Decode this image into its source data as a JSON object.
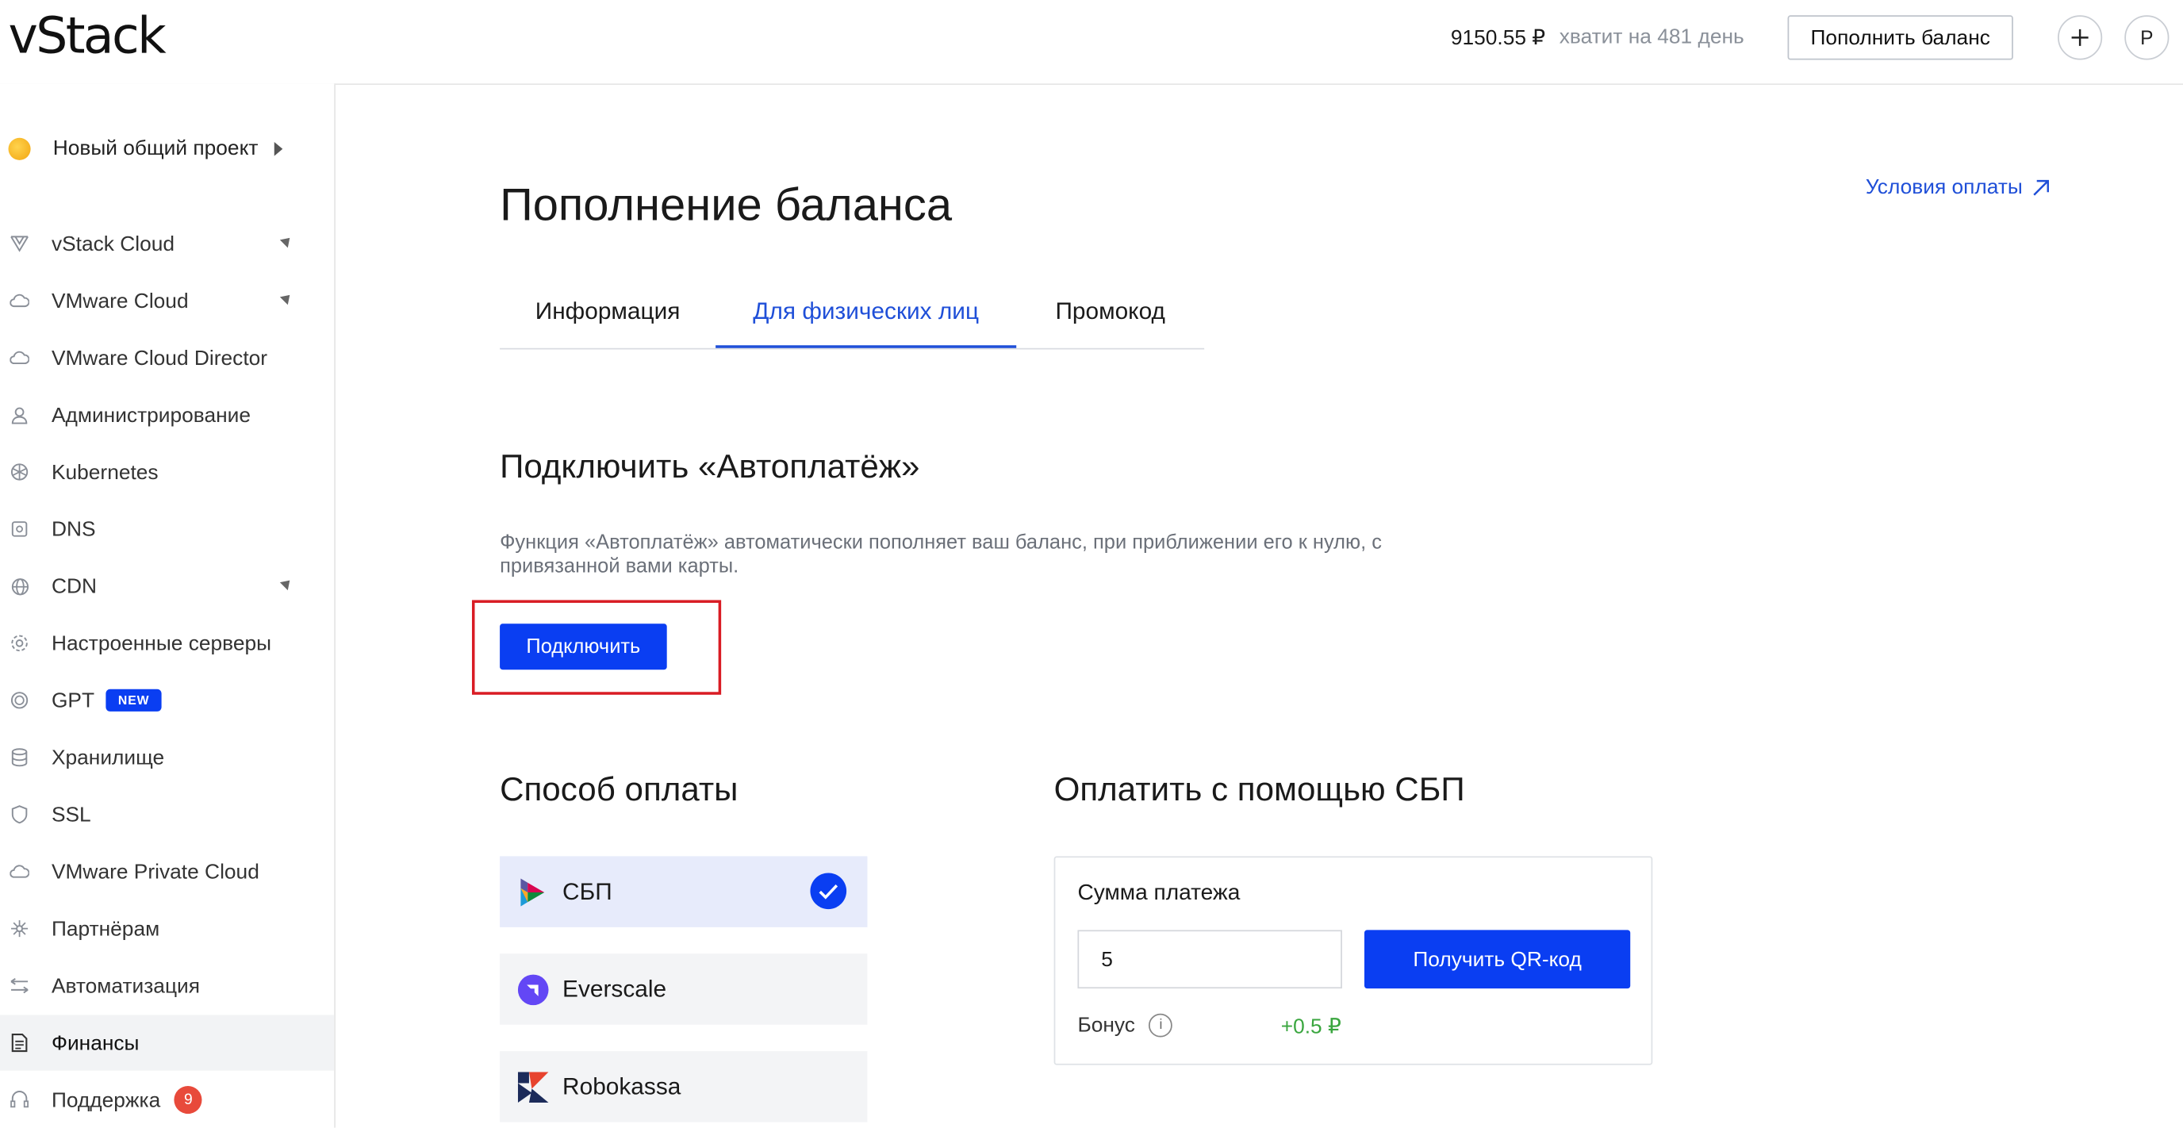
{
  "header": {
    "logo": "vStack",
    "balance": "9150.55 ₽",
    "days_left": "хватит на 481 день",
    "topup_button": "Пополнить баланс",
    "add_button": "+",
    "avatar_letter": "P"
  },
  "sidebar": {
    "project": "Новый общий проект",
    "items": [
      {
        "label": "vStack Cloud",
        "icon": "vstack-icon"
      },
      {
        "label": "VMware Cloud",
        "icon": "cloud-icon"
      },
      {
        "label": "VMware Cloud Director",
        "icon": "cloud-icon"
      },
      {
        "label": "Администрирование",
        "icon": "user-icon"
      },
      {
        "label": "Kubernetes",
        "icon": "kubernetes-icon"
      },
      {
        "label": "DNS",
        "icon": "dns-icon"
      },
      {
        "label": "CDN",
        "icon": "globe-icon"
      },
      {
        "label": "Настроенные серверы",
        "icon": "gear-icon"
      },
      {
        "label": "GPT",
        "icon": "gpt-icon",
        "badge": "NEW"
      },
      {
        "label": "Хранилище",
        "icon": "database-icon"
      },
      {
        "label": "SSL",
        "icon": "shield-icon"
      },
      {
        "label": "VMware Private Cloud",
        "icon": "cloud-icon"
      },
      {
        "label": "Партнёрам",
        "icon": "partners-icon"
      },
      {
        "label": "Автоматизация",
        "icon": "arrows-icon"
      },
      {
        "label": "Финансы",
        "icon": "document-icon"
      },
      {
        "label": "Поддержка",
        "icon": "headset-icon",
        "count": "9"
      }
    ]
  },
  "main": {
    "title": "Пополнение баланса",
    "terms_link": "Условия оплаты",
    "tabs": [
      "Информация",
      "Для физических лиц",
      "Промокод"
    ],
    "autopay": {
      "heading": "Подключить «Автоплатёж»",
      "description": "Функция «Автоплатёж» автоматически пополняет ваш баланс, при приближении его к нулю, с привязанной вами карты.",
      "button": "Подключить"
    },
    "payment_method": {
      "heading": "Способ оплаты",
      "options": [
        "СБП",
        "Everscale",
        "Robokassa"
      ]
    },
    "sbp": {
      "heading": "Оплатить с помощью СБП",
      "sum_label": "Сумма платежа",
      "amount": "5",
      "qr_button": "Получить QR-код",
      "bonus_label": "Бонус",
      "bonus_value": "+0.5 ₽"
    }
  },
  "colors": {
    "accent": "#0a3ef2",
    "link": "#1f4fd8",
    "bonus": "#3aa63f",
    "highlight": "#d91c24",
    "badge_count": "#e84a3b"
  }
}
